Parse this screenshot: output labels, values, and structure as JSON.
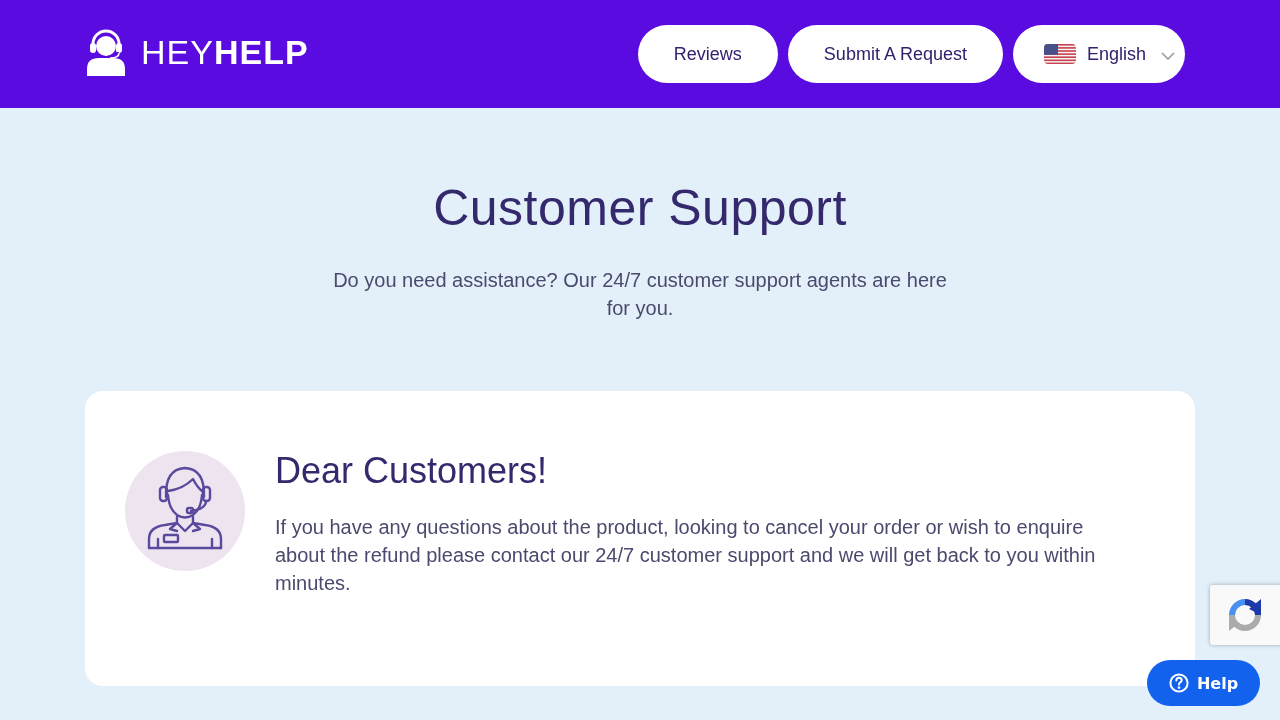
{
  "header": {
    "logo": "HEY**HELP**",
    "nav": [
      {
        "label": "Reviews"
      },
      {
        "label": "Submit A Request"
      }
    ],
    "language": {
      "value": "English"
    }
  },
  "hero": {
    "title": "Customer Support",
    "subtitle": "Do you need assistance? Our 24/7 customer support agents are here for you."
  },
  "notice": {
    "title": "Dear Customers!",
    "body": "If you have any questions about the product, looking to cancel your order or wish to enquire about the refund please contact our 24/7 customer support and we will get back to you within minutes."
  },
  "help_button": {
    "label": "Help"
  }
}
